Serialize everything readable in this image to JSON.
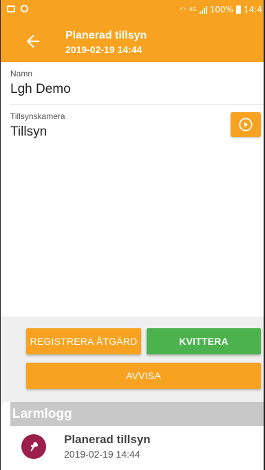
{
  "status_bar": {
    "battery_text": "100%",
    "time": "14:4",
    "network": "4G",
    "background": "#f7a321"
  },
  "app_bar": {
    "title": "Planerad tillsyn",
    "subtitle": "2019-02-19 14:44",
    "back_icon": "arrow-left-icon",
    "background": "#f7a321"
  },
  "fields": {
    "name": {
      "label": "Namn",
      "value": "Lgh Demo"
    },
    "camera": {
      "label": "Tillsynskamera",
      "value": "Tillsyn",
      "action_icon": "play-circle-icon"
    }
  },
  "actions": {
    "register": "REGISTRERA ÅTGÄRD",
    "acknowledge": "KVITTERA",
    "reject": "AVVISA",
    "colors": {
      "orange": "#f7a321",
      "green": "#4cb24e"
    }
  },
  "alarm_log": {
    "header": "Larmlogg",
    "items": [
      {
        "title": "Planerad tillsyn",
        "time": "2019-02-19 14:44",
        "icon": "alarm-type-icon",
        "icon_bg": "#9b1f4a"
      }
    ]
  }
}
